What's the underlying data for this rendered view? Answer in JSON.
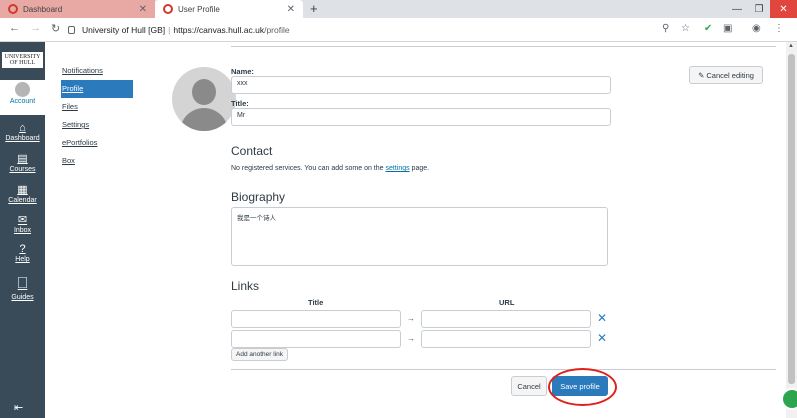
{
  "browser": {
    "tabs": [
      {
        "title": "Dashboard",
        "active": false
      },
      {
        "title": "User Profile",
        "active": true
      }
    ],
    "new_tab": "+",
    "address": {
      "org": "University of Hull [GB]",
      "separator": "|",
      "url_host": "https://canvas.hull.ac.uk",
      "url_path": "/profile"
    }
  },
  "global_nav": {
    "logo_text": "UNIVERSITY OF HULL",
    "items": [
      {
        "label": "Account",
        "icon": "avatar-icon"
      },
      {
        "label": "Dashboard",
        "icon": "dashboard-icon"
      },
      {
        "label": "Courses",
        "icon": "courses-icon"
      },
      {
        "label": "Calendar",
        "icon": "calendar-icon"
      },
      {
        "label": "Inbox",
        "icon": "inbox-icon"
      },
      {
        "label": "Help",
        "icon": "help-icon"
      },
      {
        "label": "Guides",
        "icon": "guides-icon"
      }
    ]
  },
  "sub_nav": {
    "items": [
      "Notifications",
      "Profile",
      "Files",
      "Settings",
      "ePortfolios",
      "Box"
    ],
    "active": "Profile"
  },
  "profile": {
    "name_label": "Name:",
    "name_value": "xxx",
    "title_label": "Title:",
    "title_value": "Mr",
    "cancel_editing": "Cancel editing",
    "contact_heading": "Contact",
    "contact_text_pre": "No registered services. You can add some on the ",
    "contact_link": "settings",
    "contact_text_post": " page.",
    "bio_heading": "Biography",
    "bio_value": "我是一个诗人",
    "links_heading": "Links",
    "links_col_title": "Title",
    "links_col_url": "URL",
    "add_link": "Add another link",
    "cancel_button": "Cancel",
    "save_button": "Save profile"
  },
  "colors": {
    "accent": "#2b7abc",
    "nav_bg": "#394b58",
    "highlight": "#e0201a"
  }
}
